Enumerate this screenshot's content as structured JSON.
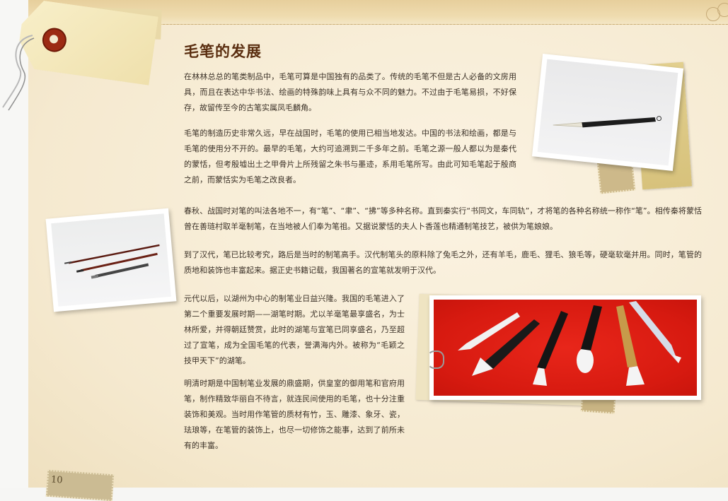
{
  "article": {
    "title": "毛笔的发展",
    "paragraphs": [
      "在林林总总的笔类制品中，毛笔可算是中国独有的品类了。传统的毛笔不但是古人必备的文房用具，而且在表达中华书法、绘画的特殊韵味上具有与众不同的魅力。不过由于毛笔易损，不好保存，故留传至今的古笔实属凤毛麟角。",
      "毛笔的制造历史非常久远，早在战国时，毛笔的使用已相当地发达。中国的书法和绘画，都是与毛笔的使用分不开的。最早的毛笔，大约可追溯到二千多年之前。毛笔之源一般人都以为是秦代的蒙恬，但考殷墟出土之甲骨片上所残留之朱书与墨迹，系用毛笔所写。由此可知毛笔起于殷商之前，而蒙恬实为毛笔之改良者。",
      "春秋、战国时对笔的叫法各地不一，有“笔”、“聿”、“拂”等多种名称。直到秦实行“书同文，车同轨”，才将笔的各种名称统一称作“笔”。相传秦将蒙恬曾在善琏村取羊毫制笔，在当地被人们奉为笔祖。又据说蒙恬的夫人卜香莲也精通制笔技艺，被供为笔娘娘。",
      "到了汉代，笔已比较考究，路后是当时的制笔高手。汉代制笔头的原料除了兔毛之外，还有羊毛，鹿毛、狸毛、狼毛等，硬毫软毫并用。同时，笔管的质地和装饰也丰富起来。据正史书籍记载，我国著名的宣笔就发明于汉代。",
      "元代以后，以湖州为中心的制笔业日益兴隆。我国的毛笔进入了第二个重要发展时期——湖笔时期。尤以羊毫笔最享盛名，为士林所爱，并得朝廷赞赏，此时的湖笔与宣笔已同享盛名，乃至超过了宣笔，成为全国毛笔的代表，誉满海内外。被称为“毛颖之技甲天下”的湖笔。",
      "明清时期是中国制笔业发展的鼎盛期，供皇室的御用笔和官府用笔，制作精致华丽自不待言，就连民间使用的毛笔，也十分注重装饰和美观。当时用作笔管的质材有竹，玉、雕漆、象牙、瓷，珐琅等，在笔管的装饰上，也尽一切修饰之能事，达到了前所未有的丰富。"
    ]
  },
  "stamp": {
    "number": "10"
  },
  "colors": {
    "title": "#5a2e10",
    "text": "#3b3127",
    "paper": "#f6ecd6",
    "red_background": "#e0201a"
  }
}
